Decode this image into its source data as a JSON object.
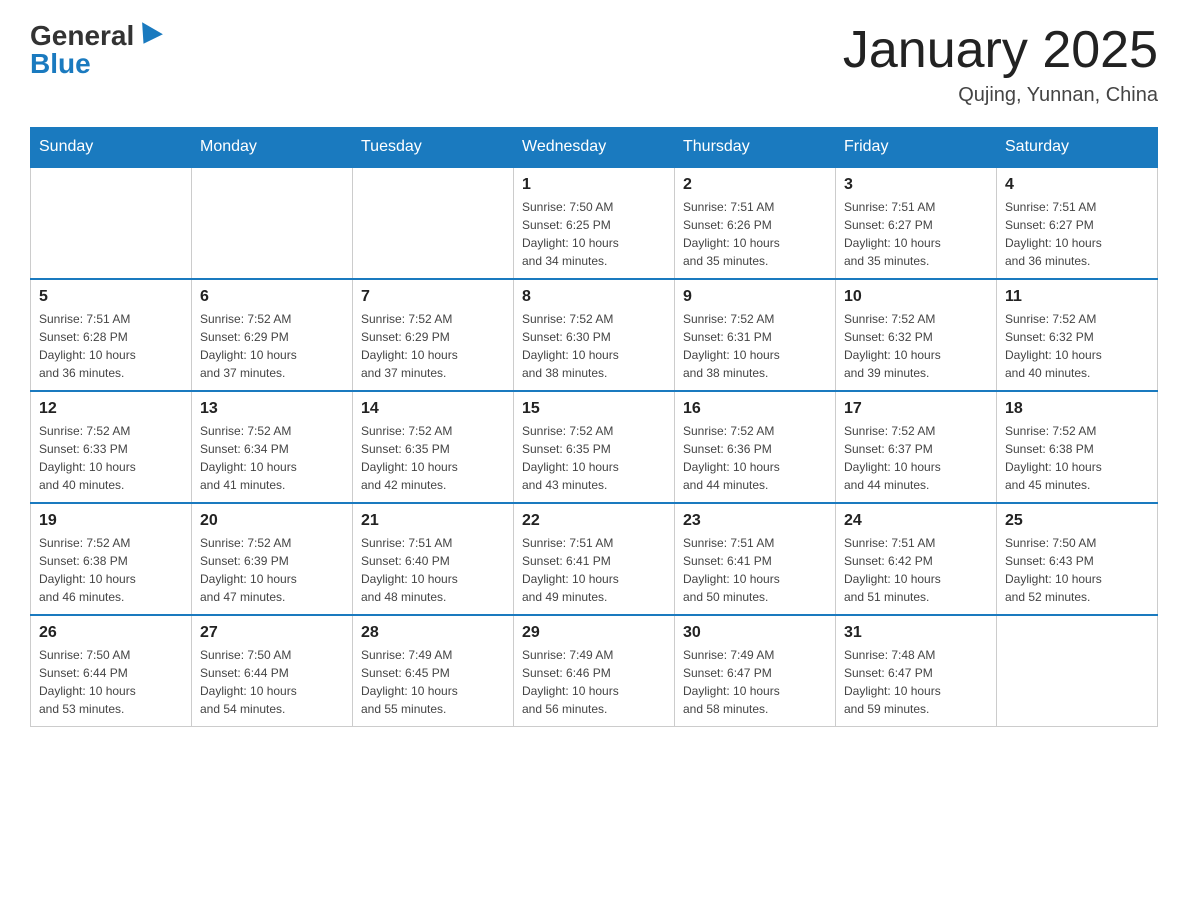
{
  "logo": {
    "general": "General",
    "blue": "Blue"
  },
  "title": "January 2025",
  "location": "Qujing, Yunnan, China",
  "days_of_week": [
    "Sunday",
    "Monday",
    "Tuesday",
    "Wednesday",
    "Thursday",
    "Friday",
    "Saturday"
  ],
  "weeks": [
    [
      {
        "day": "",
        "info": ""
      },
      {
        "day": "",
        "info": ""
      },
      {
        "day": "",
        "info": ""
      },
      {
        "day": "1",
        "info": "Sunrise: 7:50 AM\nSunset: 6:25 PM\nDaylight: 10 hours\nand 34 minutes."
      },
      {
        "day": "2",
        "info": "Sunrise: 7:51 AM\nSunset: 6:26 PM\nDaylight: 10 hours\nand 35 minutes."
      },
      {
        "day": "3",
        "info": "Sunrise: 7:51 AM\nSunset: 6:27 PM\nDaylight: 10 hours\nand 35 minutes."
      },
      {
        "day": "4",
        "info": "Sunrise: 7:51 AM\nSunset: 6:27 PM\nDaylight: 10 hours\nand 36 minutes."
      }
    ],
    [
      {
        "day": "5",
        "info": "Sunrise: 7:51 AM\nSunset: 6:28 PM\nDaylight: 10 hours\nand 36 minutes."
      },
      {
        "day": "6",
        "info": "Sunrise: 7:52 AM\nSunset: 6:29 PM\nDaylight: 10 hours\nand 37 minutes."
      },
      {
        "day": "7",
        "info": "Sunrise: 7:52 AM\nSunset: 6:29 PM\nDaylight: 10 hours\nand 37 minutes."
      },
      {
        "day": "8",
        "info": "Sunrise: 7:52 AM\nSunset: 6:30 PM\nDaylight: 10 hours\nand 38 minutes."
      },
      {
        "day": "9",
        "info": "Sunrise: 7:52 AM\nSunset: 6:31 PM\nDaylight: 10 hours\nand 38 minutes."
      },
      {
        "day": "10",
        "info": "Sunrise: 7:52 AM\nSunset: 6:32 PM\nDaylight: 10 hours\nand 39 minutes."
      },
      {
        "day": "11",
        "info": "Sunrise: 7:52 AM\nSunset: 6:32 PM\nDaylight: 10 hours\nand 40 minutes."
      }
    ],
    [
      {
        "day": "12",
        "info": "Sunrise: 7:52 AM\nSunset: 6:33 PM\nDaylight: 10 hours\nand 40 minutes."
      },
      {
        "day": "13",
        "info": "Sunrise: 7:52 AM\nSunset: 6:34 PM\nDaylight: 10 hours\nand 41 minutes."
      },
      {
        "day": "14",
        "info": "Sunrise: 7:52 AM\nSunset: 6:35 PM\nDaylight: 10 hours\nand 42 minutes."
      },
      {
        "day": "15",
        "info": "Sunrise: 7:52 AM\nSunset: 6:35 PM\nDaylight: 10 hours\nand 43 minutes."
      },
      {
        "day": "16",
        "info": "Sunrise: 7:52 AM\nSunset: 6:36 PM\nDaylight: 10 hours\nand 44 minutes."
      },
      {
        "day": "17",
        "info": "Sunrise: 7:52 AM\nSunset: 6:37 PM\nDaylight: 10 hours\nand 44 minutes."
      },
      {
        "day": "18",
        "info": "Sunrise: 7:52 AM\nSunset: 6:38 PM\nDaylight: 10 hours\nand 45 minutes."
      }
    ],
    [
      {
        "day": "19",
        "info": "Sunrise: 7:52 AM\nSunset: 6:38 PM\nDaylight: 10 hours\nand 46 minutes."
      },
      {
        "day": "20",
        "info": "Sunrise: 7:52 AM\nSunset: 6:39 PM\nDaylight: 10 hours\nand 47 minutes."
      },
      {
        "day": "21",
        "info": "Sunrise: 7:51 AM\nSunset: 6:40 PM\nDaylight: 10 hours\nand 48 minutes."
      },
      {
        "day": "22",
        "info": "Sunrise: 7:51 AM\nSunset: 6:41 PM\nDaylight: 10 hours\nand 49 minutes."
      },
      {
        "day": "23",
        "info": "Sunrise: 7:51 AM\nSunset: 6:41 PM\nDaylight: 10 hours\nand 50 minutes."
      },
      {
        "day": "24",
        "info": "Sunrise: 7:51 AM\nSunset: 6:42 PM\nDaylight: 10 hours\nand 51 minutes."
      },
      {
        "day": "25",
        "info": "Sunrise: 7:50 AM\nSunset: 6:43 PM\nDaylight: 10 hours\nand 52 minutes."
      }
    ],
    [
      {
        "day": "26",
        "info": "Sunrise: 7:50 AM\nSunset: 6:44 PM\nDaylight: 10 hours\nand 53 minutes."
      },
      {
        "day": "27",
        "info": "Sunrise: 7:50 AM\nSunset: 6:44 PM\nDaylight: 10 hours\nand 54 minutes."
      },
      {
        "day": "28",
        "info": "Sunrise: 7:49 AM\nSunset: 6:45 PM\nDaylight: 10 hours\nand 55 minutes."
      },
      {
        "day": "29",
        "info": "Sunrise: 7:49 AM\nSunset: 6:46 PM\nDaylight: 10 hours\nand 56 minutes."
      },
      {
        "day": "30",
        "info": "Sunrise: 7:49 AM\nSunset: 6:47 PM\nDaylight: 10 hours\nand 58 minutes."
      },
      {
        "day": "31",
        "info": "Sunrise: 7:48 AM\nSunset: 6:47 PM\nDaylight: 10 hours\nand 59 minutes."
      },
      {
        "day": "",
        "info": ""
      }
    ]
  ]
}
